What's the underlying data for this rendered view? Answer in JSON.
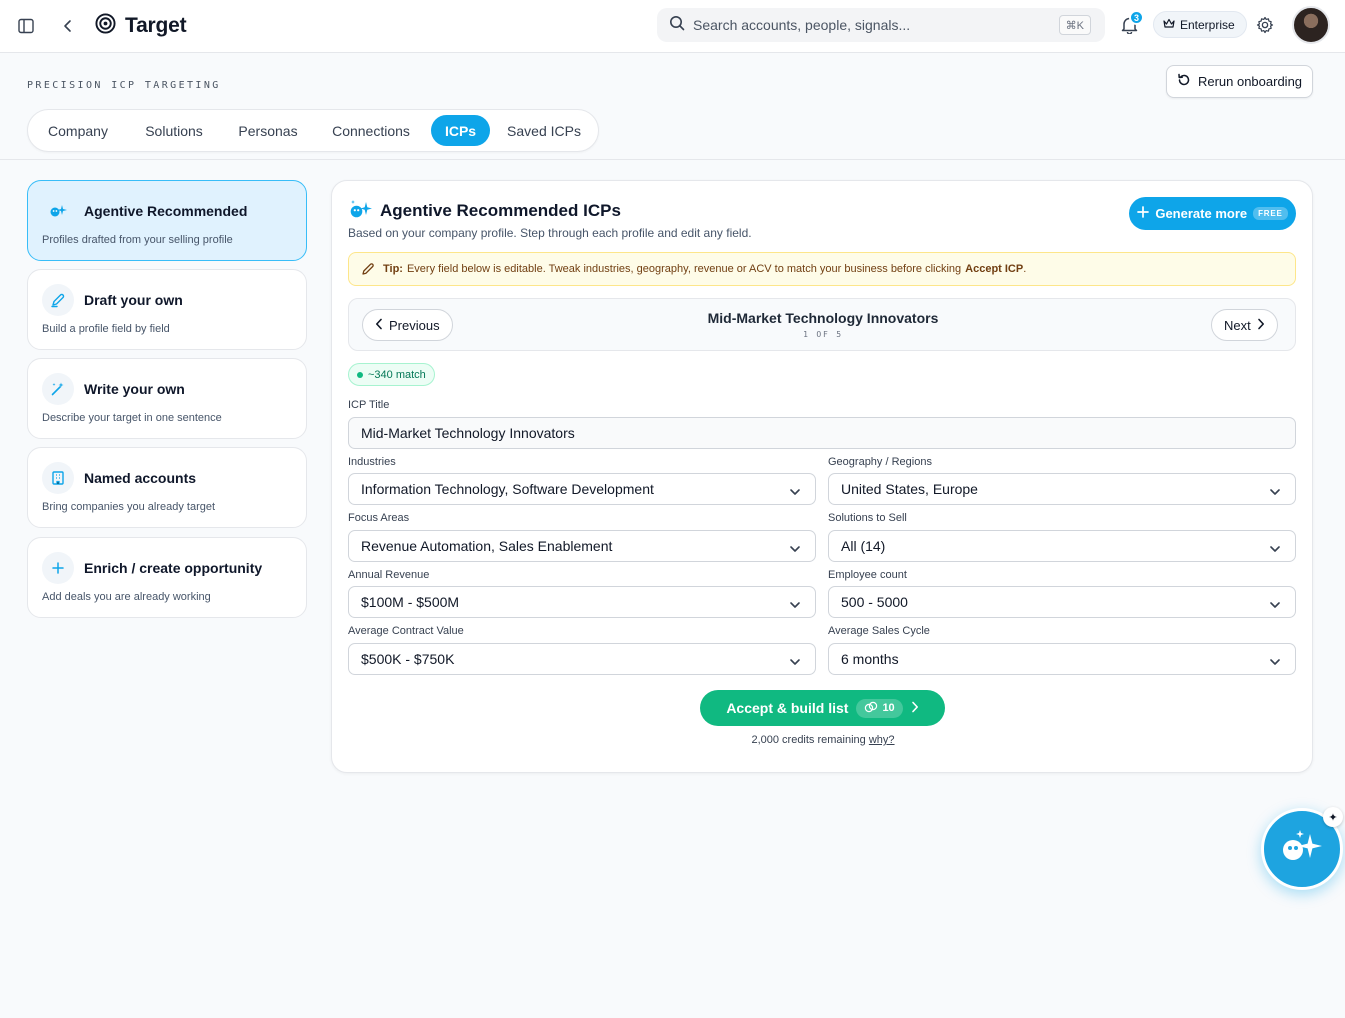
{
  "app": {
    "brand_name": "Target",
    "search_placeholder": "Search accounts, people, signals...",
    "search_shortcut": "⌘K",
    "notification_count": "3",
    "plan_label": "Enterprise"
  },
  "header": {
    "eyebrow": "PRECISION ICP TARGETING",
    "rerun_label": "Rerun onboarding",
    "tabs": [
      {
        "label": "Company",
        "active": false
      },
      {
        "label": "Solutions",
        "active": false
      },
      {
        "label": "Personas",
        "active": false
      },
      {
        "label": "Connections",
        "active": false
      },
      {
        "label": "ICPs",
        "active": true
      },
      {
        "label": "Saved ICPs",
        "active": false
      }
    ]
  },
  "options": [
    {
      "title": "Agentive Recommended",
      "desc": "Profiles drafted from your selling profile",
      "icon": "sparkle-icon",
      "active": true
    },
    {
      "title": "Draft your own",
      "desc": "Build a profile field by field",
      "icon": "pen-icon",
      "active": false
    },
    {
      "title": "Write your own",
      "desc": "Describe your target in one sentence",
      "icon": "magic-wand-icon",
      "active": false
    },
    {
      "title": "Named accounts",
      "desc": "Bring companies you already target",
      "icon": "building-icon",
      "active": false
    },
    {
      "title": "Enrich / create opportunity",
      "desc": "Add deals you are already working",
      "icon": "plus-icon",
      "active": false
    }
  ],
  "card": {
    "title": "Agentive Recommended ICPs",
    "subtitle": "Based on your company profile. Step through each profile and edit any field.",
    "generate_label": "Generate more",
    "generate_badge": "FREE",
    "tip_label": "Tip:",
    "tip_text": "Every field below is editable. Tweak industries, geography, revenue or ACV to match your business before clicking",
    "tip_action": "Accept ICP",
    "tip_end": ".",
    "pager": {
      "previous_label": "Previous",
      "next_label": "Next",
      "profile_name": "Mid-Market Technology Innovators",
      "position": "1 OF 5"
    },
    "match_label": "~340 match",
    "fields": {
      "icp_title": {
        "label": "ICP Title",
        "value": "Mid-Market Technology Innovators"
      },
      "industries": {
        "label": "Industries",
        "value": "Information Technology, Software Development"
      },
      "geography": {
        "label": "Geography / Regions",
        "value": "United States, Europe"
      },
      "focus_areas": {
        "label": "Focus Areas",
        "value": "Revenue Automation, Sales Enablement"
      },
      "solutions": {
        "label": "Solutions to Sell",
        "value": "All (14)"
      },
      "revenue": {
        "label": "Annual Revenue",
        "value": "$100M - $500M"
      },
      "employees": {
        "label": "Employee count",
        "value": "500 - 5000"
      },
      "acv": {
        "label": "Average Contract Value",
        "value": "$500K - $750K"
      },
      "sales_cycle": {
        "label": "Average Sales Cycle",
        "value": "6 months"
      }
    },
    "accept_label": "Accept & build list",
    "accept_cost": "10",
    "credits_text": "2,000 credits remaining",
    "credits_why": "why?"
  },
  "colors": {
    "accent": "#0ea5e9",
    "success": "#10b981",
    "tip_bg": "#fefce8"
  }
}
